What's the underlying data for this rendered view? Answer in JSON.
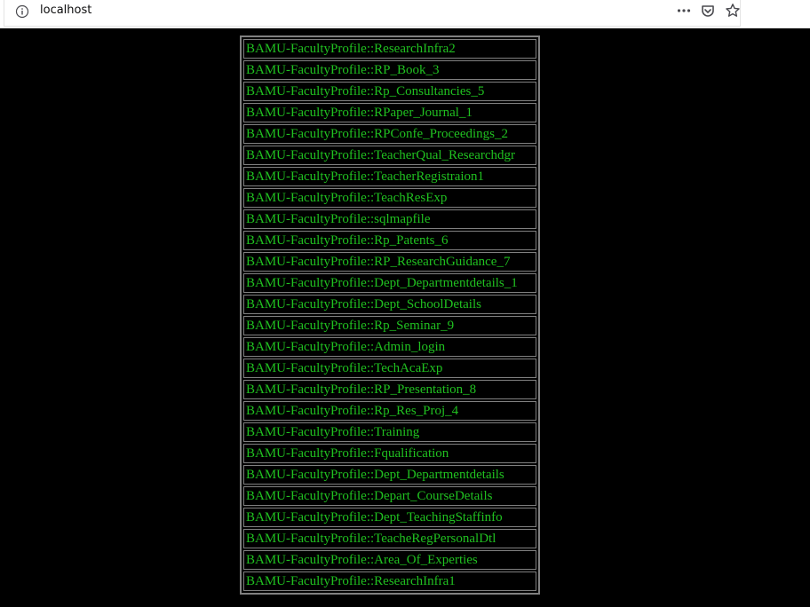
{
  "browser": {
    "url": "localhost",
    "icons": [
      "info-icon",
      "more-icon",
      "pocket-icon",
      "star-icon"
    ]
  },
  "colors": {
    "background": "#000000",
    "text": "#20c020",
    "border": "#808080"
  },
  "items": [
    "BAMU-FacultyProfile::ResearchInfra2",
    "BAMU-FacultyProfile::RP_Book_3",
    "BAMU-FacultyProfile::Rp_Consultancies_5",
    "BAMU-FacultyProfile::RPaper_Journal_1",
    "BAMU-FacultyProfile::RPConfe_Proceedings_2",
    "BAMU-FacultyProfile::TeacherQual_Researchdgr",
    "BAMU-FacultyProfile::TeacherRegistraion1",
    "BAMU-FacultyProfile::TeachResExp",
    "BAMU-FacultyProfile::sqlmapfile",
    "BAMU-FacultyProfile::Rp_Patents_6",
    "BAMU-FacultyProfile::RP_ResearchGuidance_7",
    "BAMU-FacultyProfile::Dept_Departmentdetails_1",
    "BAMU-FacultyProfile::Dept_SchoolDetails",
    "BAMU-FacultyProfile::Rp_Seminar_9",
    "BAMU-FacultyProfile::Admin_login",
    "BAMU-FacultyProfile::TechAcaExp",
    "BAMU-FacultyProfile::RP_Presentation_8",
    "BAMU-FacultyProfile::Rp_Res_Proj_4",
    "BAMU-FacultyProfile::Training",
    "BAMU-FacultyProfile::Fqualification",
    "BAMU-FacultyProfile::Dept_Departmentdetails",
    "BAMU-FacultyProfile::Depart_CourseDetails",
    "BAMU-FacultyProfile::Dept_TeachingStaffinfo",
    "BAMU-FacultyProfile::TeacheRegPersonalDtl",
    "BAMU-FacultyProfile::Area_Of_Experties",
    "BAMU-FacultyProfile::ResearchInfra1"
  ]
}
